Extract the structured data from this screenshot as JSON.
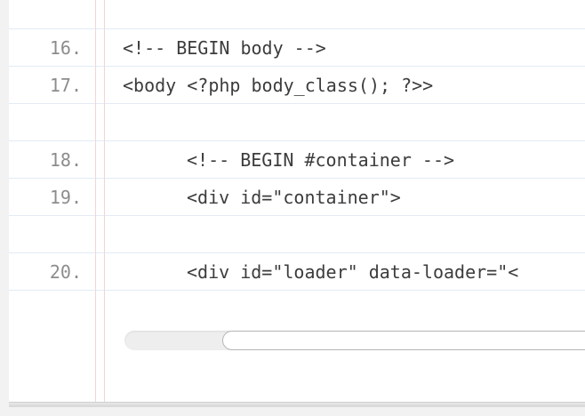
{
  "code_lines": [
    {
      "number": "16.",
      "code": "<!-- BEGIN body -->"
    },
    {
      "number": "17.",
      "code": "<body <?php body_class(); ?>>"
    },
    {
      "number": "18.",
      "code": "<!-- BEGIN #container -->"
    },
    {
      "number": "19.",
      "code": "<div id=\"container\">"
    },
    {
      "number": "20.",
      "code": "<div id=\"loader\" data-loader=\"<"
    }
  ],
  "colors": {
    "rule_line": "#e3ebf4",
    "margin_line": "#f2d6d6",
    "line_number": "#8c8c8c",
    "code_text": "#3c3c3c"
  }
}
